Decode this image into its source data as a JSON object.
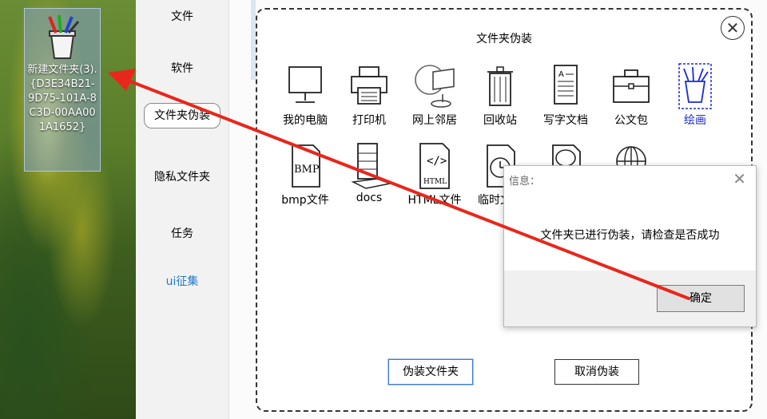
{
  "desktop": {
    "icon_label": "新建文件夹(3).{D3E34B21-9D75-101A-8C3D-00AA001A1652}"
  },
  "nav": {
    "items": [
      {
        "label": "文件"
      },
      {
        "label": "软件"
      },
      {
        "label": "文件夹伪装"
      },
      {
        "label": "隐私文件夹"
      },
      {
        "label": "任务"
      },
      {
        "label": "ui征集"
      }
    ]
  },
  "panel": {
    "title": "文件夹伪装",
    "row1": [
      {
        "label": "我的电脑",
        "icon": "computer-icon"
      },
      {
        "label": "打印机",
        "icon": "printer-icon"
      },
      {
        "label": "网上邻居",
        "icon": "network-icon"
      },
      {
        "label": "回收站",
        "icon": "recycle-bin-icon"
      },
      {
        "label": "写字文档",
        "icon": "document-icon"
      },
      {
        "label": "公文包",
        "icon": "briefcase-icon"
      },
      {
        "label": "绘画",
        "icon": "paint-icon"
      }
    ],
    "row2": [
      {
        "label": "bmp文件",
        "icon": "bmp-icon"
      },
      {
        "label": "docs",
        "icon": "docs-icon"
      },
      {
        "label": "HTML文件",
        "icon": "html-icon"
      },
      {
        "label": "临时文件",
        "icon": "clock-icon"
      },
      {
        "label": "",
        "icon": "code-icon"
      },
      {
        "label": "",
        "icon": "globe-icon"
      }
    ],
    "disguise_button": "伪装文件夹",
    "cancel_button": "取消伪装"
  },
  "dialog": {
    "title": "信息：",
    "message": "文件夹已进行伪装，请检查是否成功",
    "ok_button": "确定"
  },
  "colors": {
    "selected_label": "#1b2bd6",
    "link_blue": "#1f7ad0",
    "arrow_red": "#e8271c"
  }
}
